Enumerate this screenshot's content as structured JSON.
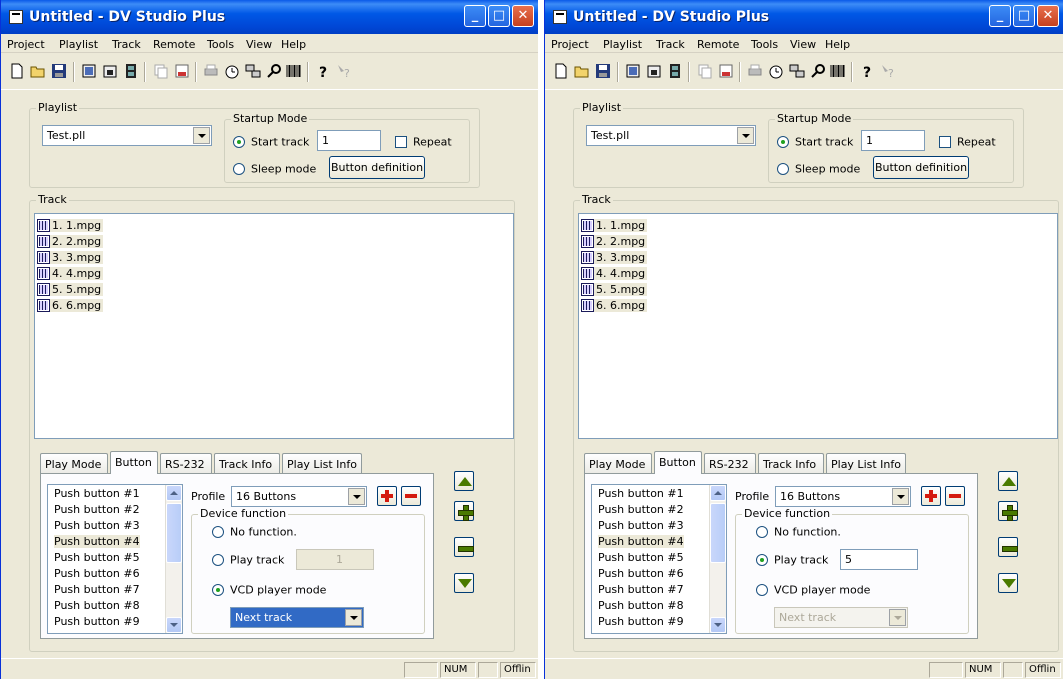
{
  "windows": [
    {
      "title": "Untitled - DV Studio Plus",
      "menu": [
        "Project",
        "Playlist",
        "Track",
        "Remote",
        "Tools",
        "View",
        "Help"
      ],
      "playlist_label": "Playlist",
      "playlist_value": "Test.pll",
      "startup_label": "Startup Mode",
      "start_track_label": "Start track",
      "start_track_value": "1",
      "repeat_label": "Repeat",
      "sleep_mode_label": "Sleep mode",
      "button_definition_label": "Button definition",
      "track_label": "Track",
      "tracks": [
        "1. 1.mpg",
        "2. 2.mpg",
        "3. 3.mpg",
        "4. 4.mpg",
        "5. 5.mpg",
        "6. 6.mpg"
      ],
      "tabs": [
        "Play Mode",
        "Button",
        "RS-232",
        "Track Info",
        "Play List Info"
      ],
      "push_buttons": [
        "Push button #1",
        "Push button #2",
        "Push button #3",
        "Push button #4",
        "Push button #5",
        "Push button #6",
        "Push button #7",
        "Push button #8",
        "Push button #9"
      ],
      "profile_label": "Profile",
      "profile_value": "16 Buttons",
      "device_function_label": "Device function",
      "no_function_label": "No function.",
      "play_track_label": "Play track",
      "play_track_value": "1",
      "vcd_mode_label": "VCD player mode",
      "vcd_value": "Next track",
      "selected_mode": "vcd",
      "status_num": "NUM",
      "status_offline": "Offlin"
    },
    {
      "title": "Untitled - DV Studio Plus",
      "menu": [
        "Project",
        "Playlist",
        "Track",
        "Remote",
        "Tools",
        "View",
        "Help"
      ],
      "playlist_label": "Playlist",
      "playlist_value": "Test.pll",
      "startup_label": "Startup Mode",
      "start_track_label": "Start track",
      "start_track_value": "1",
      "repeat_label": "Repeat",
      "sleep_mode_label": "Sleep mode",
      "button_definition_label": "Button definition",
      "track_label": "Track",
      "tracks": [
        "1. 1.mpg",
        "2. 2.mpg",
        "3. 3.mpg",
        "4. 4.mpg",
        "5. 5.mpg",
        "6. 6.mpg"
      ],
      "tabs": [
        "Play Mode",
        "Button",
        "RS-232",
        "Track Info",
        "Play List Info"
      ],
      "push_buttons": [
        "Push button #1",
        "Push button #2",
        "Push button #3",
        "Push button #4",
        "Push button #5",
        "Push button #6",
        "Push button #7",
        "Push button #8",
        "Push button #9"
      ],
      "profile_label": "Profile",
      "profile_value": "16 Buttons",
      "device_function_label": "Device function",
      "no_function_label": "No function.",
      "play_track_label": "Play track",
      "play_track_value": "5",
      "vcd_mode_label": "VCD player mode",
      "vcd_value": "Next track",
      "selected_mode": "play",
      "status_num": "NUM",
      "status_offline": "Offlin"
    }
  ],
  "toolbar_icons": [
    "new-icon",
    "open-icon",
    "save-icon",
    "import-icon",
    "export-icon",
    "film-icon",
    "copy-icon",
    "properties-icon",
    "print-icon",
    "timer-icon",
    "network-icon",
    "search-icon",
    "barcode-icon",
    "help-icon",
    "context-help-icon"
  ],
  "colors": {
    "titlebar": "#0058e6",
    "window_bg": "#ece9d8",
    "selection": "#316ac5",
    "accent_green": "#4a7a00",
    "accent_red": "#d41a0e"
  }
}
